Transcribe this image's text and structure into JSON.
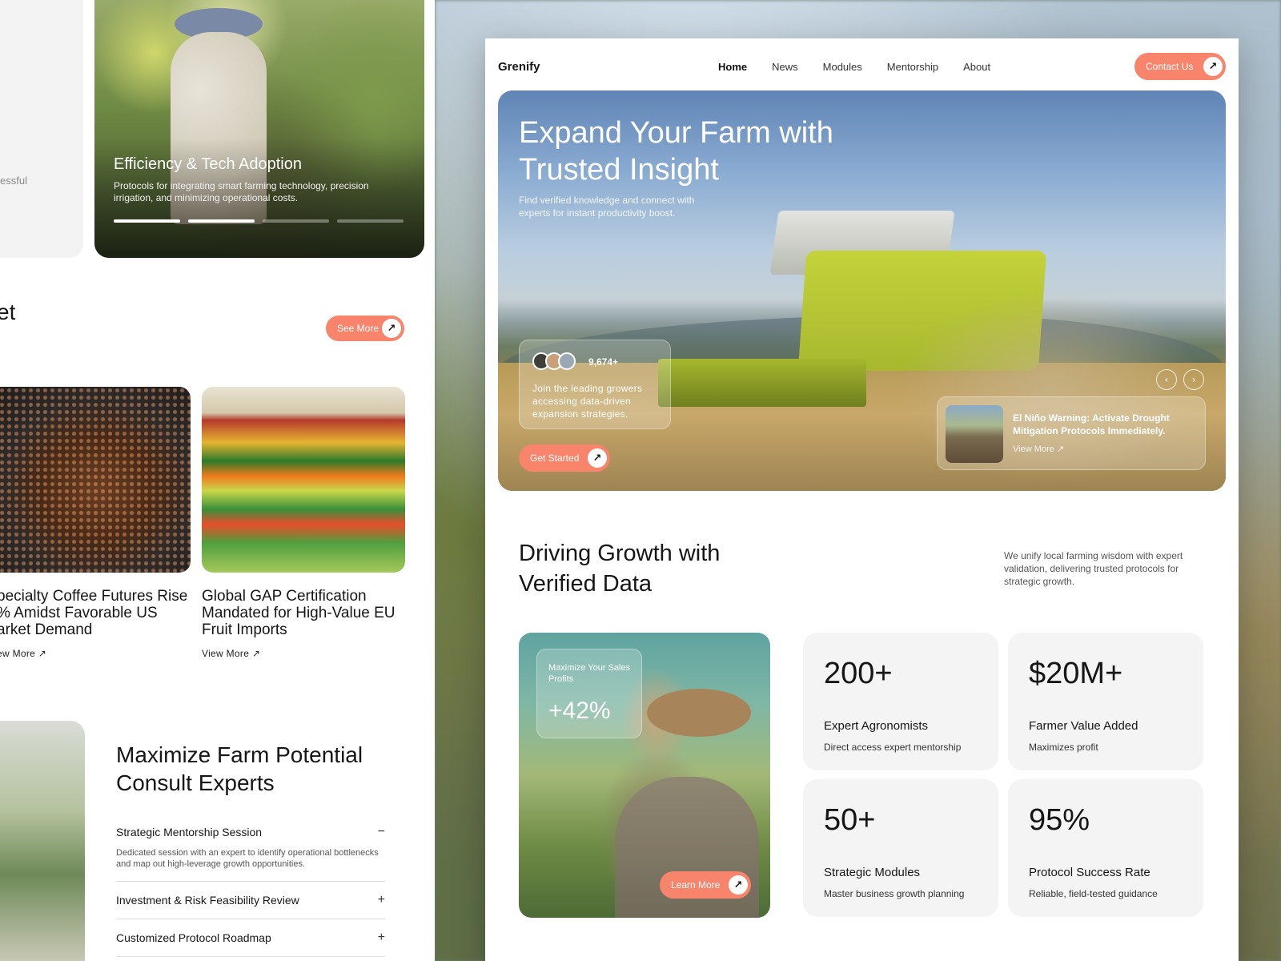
{
  "left_panel": {
    "fragment_text": "essful",
    "efficiency_card": {
      "title": "Efficiency & Tech Adoption",
      "description": "Protocols for integrating smart farming technology, precision irrigation, and minimizing operational costs."
    },
    "section_heading_fragment": "et",
    "see_more_label": "See More",
    "news": [
      {
        "title": "pecialty Coffee Futures Rise % Amidst Favorable US arket Demand",
        "link": "ew More"
      },
      {
        "title": "Global GAP Certification Mandated for High-Value EU Fruit Imports",
        "link": "View More"
      }
    ],
    "consult": {
      "title": "Maximize Farm Potential Consult Experts",
      "items": [
        {
          "title": "Strategic Mentorship Session",
          "sign": "−",
          "body": "Dedicated session with an expert to identify operational bottlenecks and map out high-leverage growth opportunities."
        },
        {
          "title": "Investment & Risk Feasibility Review",
          "sign": "+"
        },
        {
          "title": "Customized Protocol Roadmap",
          "sign": "+"
        }
      ]
    }
  },
  "site": {
    "logo": "Grenify",
    "nav": [
      "Home",
      "News",
      "Modules",
      "Mentorship",
      "About"
    ],
    "contact_label": "Contact Us",
    "hero": {
      "title": "Expand Your Farm with Trusted Insight",
      "subtitle": "Find verified knowledge and connect with experts for instant productivity boost.",
      "growers_count": "9,674+",
      "growers_text": "Join the leading growers accessing data-driven expansion strategies.",
      "cta_label": "Get Started",
      "news_card": {
        "title": "El Niño Warning: Activate Drought Mitigation Protocols Immediately.",
        "link": "View More"
      }
    },
    "growth": {
      "title": "Driving Growth with Verified Data",
      "description": "We unify local farming wisdom with expert validation, delivering trusted protocols for strategic growth."
    },
    "profit_card": {
      "label": "Maximize Your Sales Profits",
      "value": "+42%"
    },
    "learn_more_label": "Learn More",
    "stats": [
      {
        "value": "200+",
        "label": "Expert Agronomists",
        "sub": "Direct access expert mentorship"
      },
      {
        "value": "$20M+",
        "label": "Farmer Value Added",
        "sub": "Maximizes profit"
      },
      {
        "value": "50+",
        "label": "Strategic Modules",
        "sub": "Master business growth planning"
      },
      {
        "value": "95%",
        "label": "Protocol Success Rate",
        "sub": "Reliable, field-tested guidance"
      }
    ]
  },
  "colors": {
    "accent": "#f7846b",
    "card_gray": "#f4f4f4"
  },
  "icons": {
    "arrow": "arrow-up-right-icon",
    "prev": "chevron-left-icon",
    "next": "chevron-right-icon"
  }
}
